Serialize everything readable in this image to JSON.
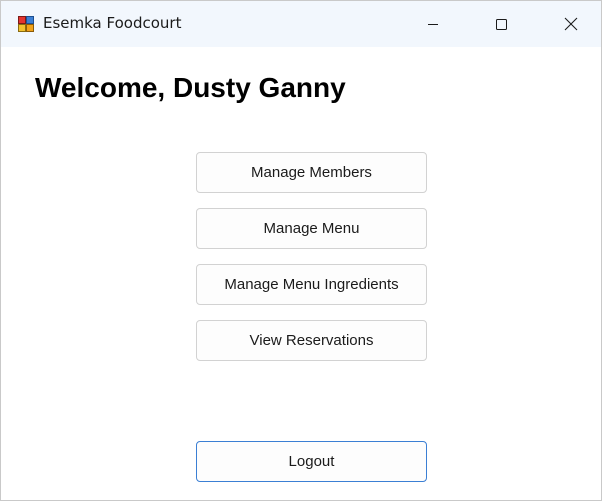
{
  "window": {
    "title": "Esemka Foodcourt",
    "icon": "windows-forms-app-icon",
    "controls": [
      "minimize-icon",
      "maximize-icon",
      "close-icon"
    ]
  },
  "main": {
    "welcome_text": "Welcome, Dusty Ganny",
    "buttons": {
      "manage_members": "Manage Members",
      "manage_menu": "Manage Menu",
      "manage_menu_ingredients": "Manage Menu Ingredients",
      "view_reservations": "View Reservations",
      "logout": "Logout"
    }
  },
  "colors": {
    "titlebar_bg": "#f2f7fd",
    "default_button_border": "#3b7fd4",
    "button_border": "#d2d2d2"
  }
}
